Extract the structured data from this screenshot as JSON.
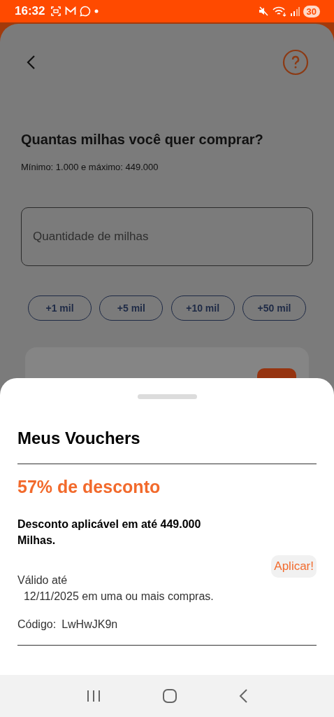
{
  "status_bar": {
    "time": "16:32",
    "battery": "30"
  },
  "page": {
    "title": "Quantas milhas você quer comprar?",
    "subtitle": "Mínimo: 1.000 e máximo: 449.000",
    "input": {
      "placeholder": "Quantidade de milhas"
    },
    "quick_buttons": [
      "+1 mil",
      "+5 mil",
      "+10 mil",
      "+50 mil"
    ]
  },
  "sheet": {
    "title": "Meus Vouchers",
    "vouchers": [
      {
        "discount": "57% de desconto",
        "description": "Desconto aplicável em até 449.000 Milhas.",
        "validity": "Válido até\n  12/11/2025 em uma ou mais compras.",
        "code_label": "Código:",
        "code": "LwHwJK9n",
        "apply": "Aplicar!"
      }
    ]
  }
}
